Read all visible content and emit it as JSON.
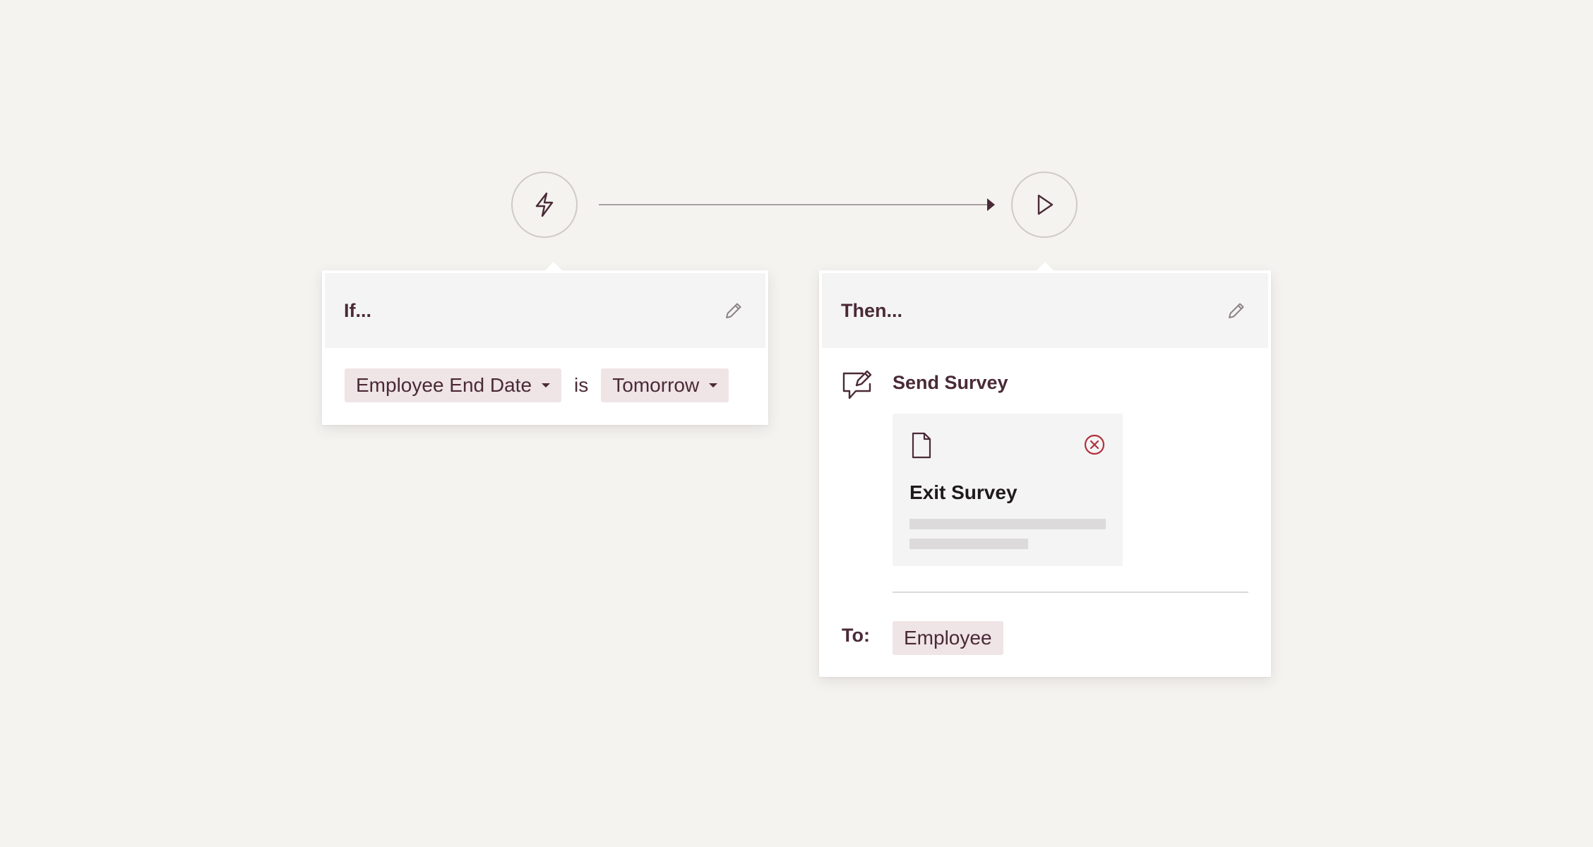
{
  "flow": {
    "trigger_icon": "lightning-bolt-icon",
    "action_icon": "play-icon"
  },
  "if_card": {
    "title": "If...",
    "edit_icon": "pencil-icon",
    "condition": {
      "field": "Employee End Date",
      "operator": "is",
      "value": "Tomorrow"
    }
  },
  "then_card": {
    "title": "Then...",
    "edit_icon": "pencil-icon",
    "action": {
      "icon": "chat-pencil-icon",
      "label": "Send Survey"
    },
    "survey": {
      "icon": "document-icon",
      "name": "Exit Survey",
      "remove_icon": "close-circle-icon"
    },
    "recipient_label": "To:",
    "recipient": "Employee"
  },
  "colors": {
    "background": "#f4f3ef",
    "text": "#4a2a37",
    "pill": "#efe4e6",
    "remove": "#b0313d"
  }
}
